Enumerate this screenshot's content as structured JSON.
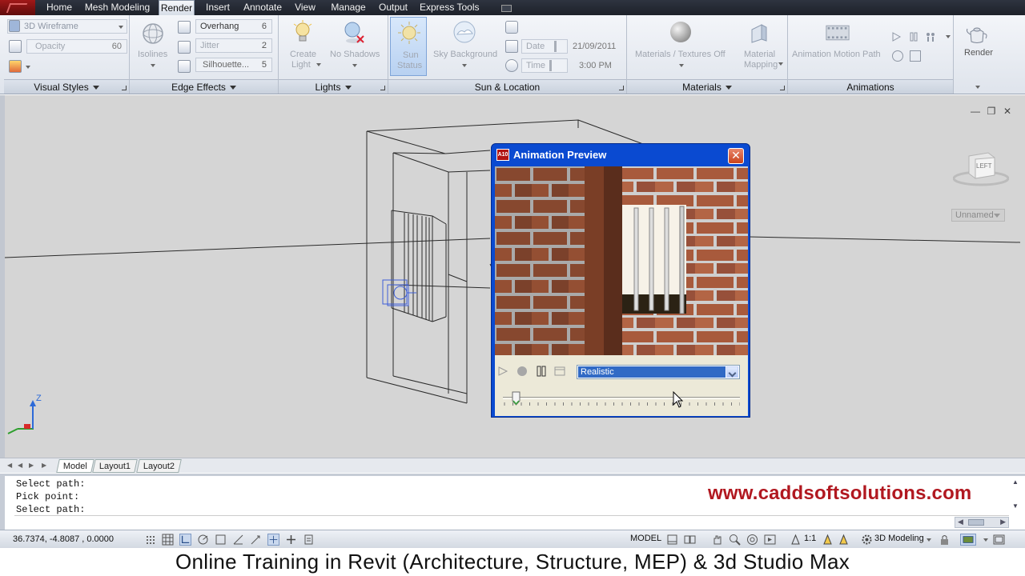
{
  "menu": {
    "tabs": [
      "Home",
      "Mesh Modeling",
      "Render",
      "Insert",
      "Annotate",
      "View",
      "Manage",
      "Output",
      "Express Tools"
    ],
    "active": "Render"
  },
  "ribbon": {
    "visual_styles": {
      "label": "Visual Styles",
      "style_value": "3D Wireframe",
      "opacity_label": "Opacity",
      "opacity_value": "60"
    },
    "edge_effects": {
      "label": "Edge Effects",
      "isolines": "Isolines",
      "overhang_label": "Overhang",
      "overhang_value": "6",
      "jitter_label": "Jitter",
      "jitter_value": "2",
      "silhouette_label": "Silhouette...",
      "silhouette_value": "5"
    },
    "lights": {
      "label": "Lights",
      "create_light_1": "Create",
      "create_light_2": "Light",
      "no_shadows": "No Shadows"
    },
    "sun_location": {
      "label": "Sun & Location",
      "sun_status_1": "Sun",
      "sun_status_2": "Status",
      "sky_background": "Sky Background",
      "date_label": "Date",
      "date_value": "21/09/2011",
      "time_label": "Time",
      "time_value": "3:00 PM"
    },
    "materials": {
      "label": "Materials",
      "materials_textures": "Materials / Textures Off",
      "material_mapping_1": "Material",
      "material_mapping_2": "Mapping"
    },
    "animations": {
      "label": "Animations",
      "motion_path": "Animation Motion Path"
    },
    "render": {
      "label": "Render"
    }
  },
  "viewport": {
    "viewcube_face": "LEFT",
    "named_view": "Unnamed",
    "ucs_z": "Z"
  },
  "dialog": {
    "title": "Animation Preview",
    "app_badge": "A10",
    "visual_style_value": "Realistic",
    "slider_position": 0.05
  },
  "layout_tabs": [
    "Model",
    "Layout1",
    "Layout2"
  ],
  "command_lines": [
    "Select path:",
    "Pick point:",
    "Select path:"
  ],
  "watermark": "www.caddsoftsolutions.com",
  "status": {
    "coordinates": "36.7374, -4.8087 , 0.0000",
    "model": "MODEL",
    "scale": "1:1",
    "workspace": "3D Modeling"
  },
  "banner": "Online Training in Revit (Architecture, Structure, MEP) & 3d Studio Max",
  "colors": {
    "menubar": "#1d2129",
    "dialog_title": "#0a4ad1",
    "selection": "#316ac5",
    "watermark": "#b11820"
  }
}
